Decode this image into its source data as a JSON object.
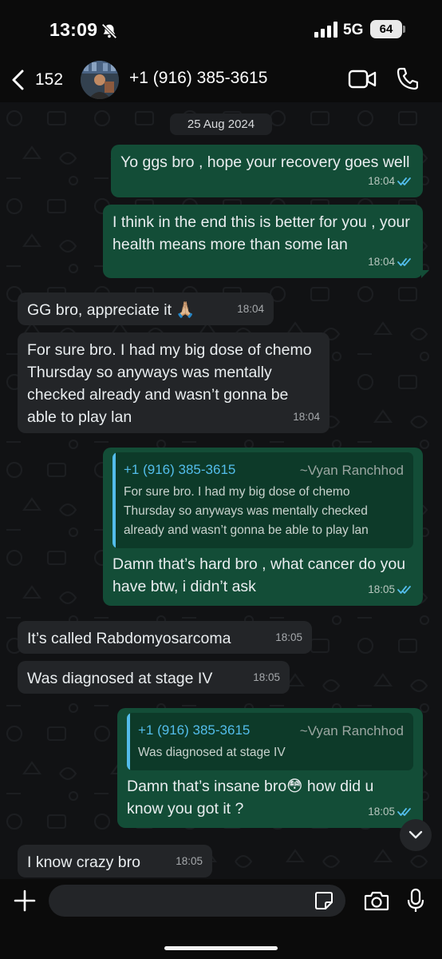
{
  "status_bar": {
    "time": "13:09",
    "network": "5G",
    "battery": "64",
    "icons": [
      "bell-slash-icon",
      "signal-bars-icon"
    ]
  },
  "header": {
    "back_count": "152",
    "contact_name": "+1 (916) 385-3615",
    "icons": [
      "chevron-left-icon",
      "video-call-icon",
      "phone-icon"
    ]
  },
  "chat": {
    "date_chip": "25 Aug 2024",
    "messages": [
      {
        "direction": "outgoing",
        "text": "Yo ggs bro , hope your recovery goes well",
        "time": "18:04",
        "read": true
      },
      {
        "direction": "outgoing",
        "text": "I think in the end this is better for you , your health means more than some lan",
        "time": "18:04",
        "read": true
      },
      {
        "direction": "incoming",
        "text": "GG bro, appreciate it 🙏🏼",
        "time": "18:04"
      },
      {
        "direction": "incoming",
        "text": "For sure bro. I had my big dose of chemo Thursday so anyways was mentally checked already and wasn’t gonna be able to play lan",
        "time": "18:04"
      },
      {
        "direction": "outgoing",
        "reply_to": {
          "author": "+1 (916) 385-3615",
          "sender_name": "~Vyan Ranchhod",
          "text": "For sure bro. I had my big dose of chemo Thursday so anyways was mentally checked already and wasn’t gonna be able to play lan"
        },
        "text": "Damn that’s hard bro , what cancer do you have btw, i didn’t ask",
        "time": "18:05",
        "read": true
      },
      {
        "direction": "incoming",
        "text": "It’s called Rabdomyosarcoma",
        "time": "18:05"
      },
      {
        "direction": "incoming",
        "text": "Was diagnosed at stage IV",
        "time": "18:05"
      },
      {
        "direction": "outgoing",
        "reply_to": {
          "author": "+1 (916) 385-3615",
          "sender_name": "~Vyan Ranchhod",
          "text": "Was diagnosed at stage IV"
        },
        "text": "Damn that’s insane bro😳 how did u know you got it ?",
        "time": "18:05",
        "read": true
      },
      {
        "direction": "incoming",
        "text": "I know crazy bro",
        "time": "18:05"
      }
    ]
  },
  "input_bar": {
    "value": "",
    "icons": [
      "plus-icon",
      "sticker-icon",
      "camera-icon",
      "microphone-icon"
    ]
  },
  "colors": {
    "outgoing_bubble": "#134d37",
    "incoming_bubble": "#232528",
    "quote_accent": "#53bdeb",
    "read_ticks": "#53bdeb",
    "background": "#0b0b0b"
  }
}
